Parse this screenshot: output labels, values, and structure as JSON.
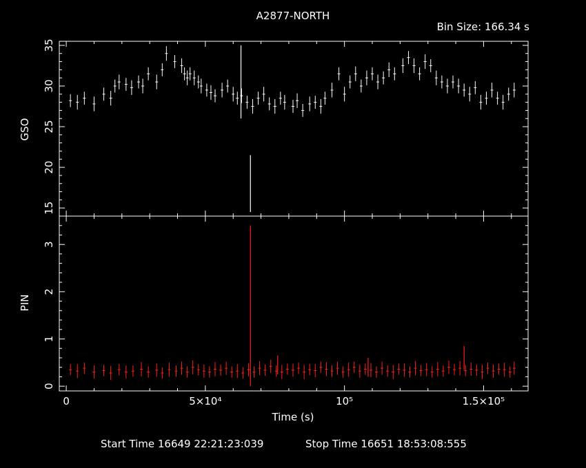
{
  "header": {
    "title": "A2877-NORTH",
    "bin_size": "Bin Size: 166.34 s"
  },
  "footer": {
    "start_time": "Start Time 16649 22:21:23:039",
    "stop_time": "Stop Time 16651 18:53:08:555"
  },
  "colors": {
    "background": "#000000",
    "axes": "#ffffff",
    "gso": "#ffffff",
    "pin": "#ff2020"
  },
  "chart_data": [
    {
      "type": "scatter",
      "title": "A2877-NORTH",
      "ylabel": "GSO",
      "xlim": [
        -2500,
        166000
      ],
      "ylim": [
        14,
        35.5
      ],
      "yticks": [
        "15",
        "20",
        "25",
        "30",
        "35"
      ],
      "series": [
        {
          "name": "GSO",
          "x": [
            1500,
            4000,
            6500,
            10000,
            13500,
            16000,
            17500,
            19000,
            21500,
            23500,
            26000,
            27500,
            29500,
            32500,
            34500,
            36000,
            39000,
            41500,
            42500,
            43500,
            44500,
            46000,
            47500,
            48500,
            50500,
            52000,
            53500,
            56000,
            58000,
            60000,
            61500,
            63000,
            65000,
            67000,
            69000,
            71000,
            73000,
            75000,
            77000,
            78500,
            81500,
            83000,
            85000,
            87500,
            89500,
            91500,
            93000,
            95500,
            98000,
            100000,
            102000,
            104000,
            106000,
            108000,
            110000,
            112000,
            114000,
            116000,
            118000,
            121000,
            123000,
            125000,
            127000,
            129000,
            131000,
            133000,
            135000,
            137000,
            139000,
            141000,
            143000,
            145000,
            147000,
            149000,
            151000,
            153000,
            155000,
            157000,
            159000,
            161000
          ],
          "y": [
            28.2,
            28.0,
            28.5,
            27.8,
            29.0,
            28.5,
            30.0,
            30.5,
            30.2,
            29.8,
            30.5,
            30.0,
            31.5,
            30.5,
            32.0,
            34.0,
            33.0,
            32.5,
            31.5,
            31.0,
            31.5,
            31.0,
            30.5,
            30.0,
            29.5,
            29.2,
            28.8,
            29.5,
            30.0,
            29.0,
            28.5,
            28.8,
            28.0,
            27.5,
            28.5,
            29.0,
            27.8,
            27.5,
            28.5,
            28.0,
            27.5,
            28.2,
            27.0,
            27.8,
            28.0,
            27.5,
            28.5,
            29.5,
            31.5,
            29.0,
            30.5,
            31.5,
            30.0,
            31.0,
            31.5,
            30.5,
            31.0,
            32.0,
            31.5,
            32.5,
            33.5,
            32.5,
            31.5,
            33.0,
            32.5,
            31.0,
            30.5,
            30.0,
            30.5,
            30.0,
            29.5,
            29.0,
            29.8,
            28.0,
            28.5,
            29.5,
            28.5,
            28.0,
            29.0,
            29.5
          ],
          "err": [
            0.8,
            0.9,
            0.8,
            0.9,
            0.8,
            0.9,
            0.8,
            0.9,
            0.8,
            0.9,
            0.8,
            0.9,
            0.8,
            0.9,
            0.8,
            0.9,
            0.8,
            0.9,
            0.8,
            0.9,
            0.8,
            0.9,
            0.8,
            0.9,
            0.8,
            0.9,
            0.8,
            0.9,
            0.8,
            0.9,
            0.8,
            0.9,
            0.8,
            0.9,
            0.8,
            0.9,
            0.8,
            0.9,
            0.8,
            0.9,
            0.8,
            0.9,
            0.8,
            0.9,
            0.8,
            0.9,
            0.8,
            0.9,
            0.8,
            0.9,
            0.8,
            0.9,
            0.8,
            0.9,
            0.8,
            0.9,
            0.8,
            0.9,
            0.8,
            0.9,
            0.8,
            0.9,
            0.8,
            0.9,
            0.8,
            0.9,
            0.8,
            0.9,
            0.8,
            0.9,
            0.8,
            0.9,
            0.8,
            0.9,
            0.8,
            0.9,
            0.8,
            0.9,
            0.8,
            0.9
          ]
        }
      ],
      "spikes": [
        {
          "x": 62800,
          "y": 30.5,
          "err": 4.5
        },
        {
          "x": 66200,
          "y": 18.0,
          "err": 3.5
        }
      ]
    },
    {
      "type": "scatter",
      "xlabel": "Time (s)",
      "ylabel": "PIN",
      "xlim": [
        -2500,
        166000
      ],
      "ylim": [
        -0.1,
        3.6
      ],
      "yticks": [
        "0",
        "1",
        "2",
        "3"
      ],
      "xticks": [
        {
          "value": 0,
          "label": "0"
        },
        {
          "value": 50000,
          "label": "5×10⁴"
        },
        {
          "value": 100000,
          "label": "10⁵"
        },
        {
          "value": 150000,
          "label": "1.5×10⁵"
        }
      ],
      "series": [
        {
          "name": "PIN",
          "x": [
            1500,
            4000,
            6500,
            10000,
            13500,
            16000,
            19000,
            21500,
            24000,
            27000,
            29500,
            32500,
            34500,
            37000,
            39500,
            41500,
            43500,
            45500,
            47500,
            49500,
            51500,
            53500,
            55500,
            57500,
            59500,
            61500,
            63500,
            65500,
            67500,
            69500,
            71500,
            73500,
            75500,
            77500,
            79500,
            81500,
            83500,
            85500,
            87500,
            89500,
            91500,
            93500,
            95500,
            97500,
            99500,
            101500,
            103500,
            105500,
            107500,
            109500,
            111500,
            113500,
            115500,
            117500,
            119500,
            121500,
            123500,
            125500,
            127500,
            129500,
            131500,
            133500,
            135500,
            137500,
            139500,
            141500,
            143500,
            145500,
            147500,
            149500,
            151500,
            153500,
            155500,
            157500,
            159500,
            161000
          ],
          "y": [
            0.35,
            0.32,
            0.38,
            0.3,
            0.33,
            0.28,
            0.35,
            0.3,
            0.32,
            0.36,
            0.3,
            0.34,
            0.28,
            0.35,
            0.32,
            0.38,
            0.3,
            0.4,
            0.35,
            0.32,
            0.3,
            0.36,
            0.34,
            0.38,
            0.3,
            0.32,
            0.28,
            0.35,
            0.3,
            0.38,
            0.34,
            0.42,
            0.32,
            0.3,
            0.36,
            0.34,
            0.38,
            0.3,
            0.35,
            0.33,
            0.4,
            0.36,
            0.32,
            0.38,
            0.3,
            0.35,
            0.4,
            0.32,
            0.36,
            0.34,
            0.3,
            0.38,
            0.32,
            0.3,
            0.36,
            0.34,
            0.3,
            0.38,
            0.33,
            0.35,
            0.3,
            0.36,
            0.32,
            0.4,
            0.35,
            0.38,
            0.33,
            0.36,
            0.34,
            0.3,
            0.38,
            0.32,
            0.36,
            0.35,
            0.3,
            0.38
          ],
          "err": [
            0.12,
            0.15,
            0.12,
            0.14,
            0.12,
            0.15,
            0.12,
            0.14,
            0.12,
            0.15,
            0.12,
            0.14,
            0.12,
            0.15,
            0.12,
            0.14,
            0.12,
            0.15,
            0.12,
            0.14,
            0.12,
            0.15,
            0.12,
            0.14,
            0.12,
            0.15,
            0.12,
            0.14,
            0.12,
            0.15,
            0.12,
            0.14,
            0.12,
            0.15,
            0.12,
            0.14,
            0.12,
            0.15,
            0.12,
            0.14,
            0.12,
            0.15,
            0.12,
            0.14,
            0.12,
            0.15,
            0.12,
            0.14,
            0.12,
            0.15,
            0.12,
            0.14,
            0.12,
            0.15,
            0.12,
            0.14,
            0.12,
            0.15,
            0.12,
            0.14,
            0.12,
            0.15,
            0.12,
            0.14,
            0.12,
            0.15,
            0.12,
            0.14,
            0.12,
            0.15,
            0.12,
            0.14,
            0.12,
            0.15,
            0.12,
            0.14
          ]
        }
      ],
      "spikes": [
        {
          "x": 66200,
          "y": 1.7,
          "err": 1.7
        },
        {
          "x": 76000,
          "y": 0.45,
          "err": 0.2
        },
        {
          "x": 108500,
          "y": 0.4,
          "err": 0.2
        },
        {
          "x": 143000,
          "y": 0.6,
          "err": 0.25
        }
      ]
    }
  ]
}
